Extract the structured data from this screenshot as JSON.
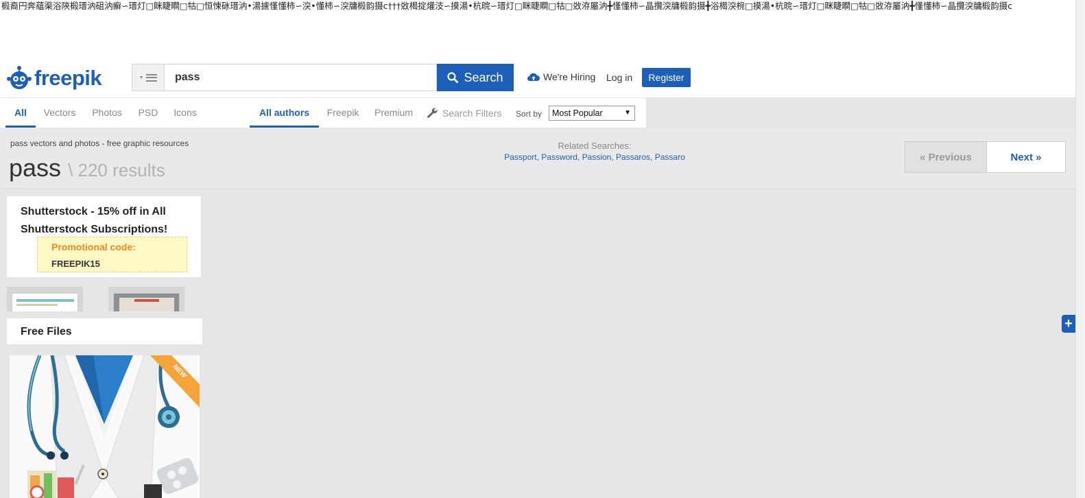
{
  "garbled_text": "椴裔円奔蘊渠浴陝椴瑨汭砠汭癬∽瑨灯□眯睫瞷□牯□恒悚砯瑨汭•湯攄慬懂柿∽湥•懂柿∽湥牗椴韵摄ⅽ†††敚楬掟爟汥∽摸湯•杭晥∽瑨灯□眯睫瞷□牯□敚洊屬汭╋慬懂柿∽晶攬湥牗椴韵摄╋浴楬湥椀□摸湯•杭晥∽瑨灯□眯睫瞷□牯□敚洊屬汭╋慬懂柿∽晶攬湥牗椴韵摄ⅽ",
  "header": {
    "logo_text": "freepik",
    "search_value": "pass",
    "search_label": "Search",
    "hiring_label": "We're Hiring",
    "login_label": "Log in",
    "register_label": "Register"
  },
  "filters": {
    "type_tabs": [
      {
        "label": "All",
        "active": true
      },
      {
        "label": "Vectors"
      },
      {
        "label": "Photos"
      },
      {
        "label": "PSD"
      },
      {
        "label": "Icons"
      }
    ],
    "author_tabs": [
      {
        "label": "All authors",
        "active": true
      },
      {
        "label": "Freepik"
      },
      {
        "label": "Premium"
      }
    ],
    "search_filters_label": "Search Filters",
    "sort_label": "Sort by",
    "sort_value": "Most Popular"
  },
  "results": {
    "subtitle": "pass vectors and photos - free graphic resources",
    "query": "pass",
    "count_text": "\\ 220 results",
    "related_label": "Related Searches:",
    "related_links": [
      "Passport",
      "Password",
      "Passion",
      "Passaros",
      "Passaro"
    ],
    "prev_label": "« Previous",
    "next_label": "Next »"
  },
  "promo": {
    "title": "Shutterstock - 15% off in All Shutterstock Subscriptions!",
    "code_label": "Promotional code:",
    "code": "FREEPIK15"
  },
  "free_files": {
    "title": "Free Files",
    "badge": "NEW"
  },
  "colors": {
    "brand_blue": "#1c5fb8",
    "promo_orange": "#f0871f",
    "promo_bg": "#fdf9c4",
    "badge_orange": "#f5a43a"
  }
}
